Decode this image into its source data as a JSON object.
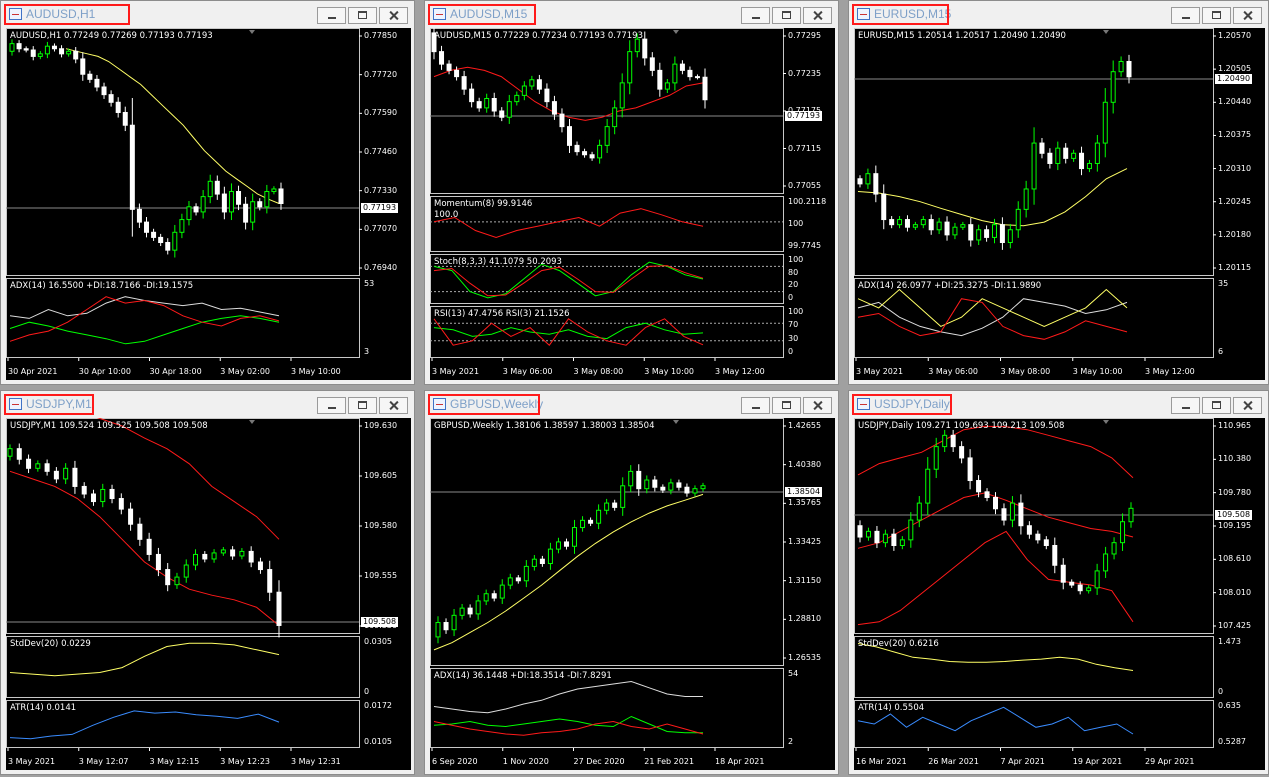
{
  "windows": [
    {
      "title": "AUDUSD,H1",
      "main": {
        "symbol_line": "AUDUSD,H1  0.77249 0.77269 0.77193 0.77193",
        "prices": [
          "0.77850",
          "0.77720",
          "0.77590",
          "0.77460",
          "0.77330",
          "0.77070",
          "0.76940"
        ],
        "current_price": "0.77193",
        "sub_panels": [
          {
            "label": "ADX(14) 16.5500 +DI:18.7166 -DI:19.1575",
            "scale": [
              "53",
              "3"
            ]
          }
        ]
      },
      "time_axis": [
        "30 Apr 2021",
        "30 Apr 10:00",
        "30 Apr 18:00",
        "3 May 02:00",
        "3 May 10:00"
      ]
    },
    {
      "title": "AUDUSD,M15",
      "main": {
        "symbol_line": "AUDUSD,M15  0.77229 0.77234 0.77193 0.77193",
        "prices": [
          "0.77295",
          "0.77235",
          "0.77175",
          "0.77115",
          "0.77055"
        ],
        "current_price": "0.77193",
        "sub_panels": [
          {
            "label": "Momentum(8) 99.9146",
            "extra": "100.0",
            "scale": [
              "100.2118",
              "100",
              "99.7745"
            ]
          },
          {
            "label": "Stoch(8,3,3) 41.1079 50.2093",
            "scale": [
              "100",
              "80",
              "20",
              "0"
            ]
          },
          {
            "label": "RSI(13) 47.4756  RSI(3) 21.1526",
            "scale": [
              "100",
              "70",
              "30",
              "0"
            ]
          }
        ]
      },
      "time_axis": [
        "3 May 2021",
        "3 May 06:00",
        "3 May 08:00",
        "3 May 10:00",
        "3 May 12:00"
      ]
    },
    {
      "title": "EURUSD,M15",
      "main": {
        "symbol_line": "EURUSD,M15  1.20514 1.20517 1.20490 1.20490",
        "prices": [
          "1.20570",
          "1.20505",
          "1.20440",
          "1.20375",
          "1.20310",
          "1.20245",
          "1.20180",
          "1.20115"
        ],
        "current_price": "1.20490",
        "sub_panels": [
          {
            "label": "ADX(14) 26.0977 +DI:25.3275 -DI:11.9890",
            "scale": [
              "35",
              "6"
            ]
          }
        ]
      },
      "time_axis": [
        "3 May 2021",
        "3 May 06:00",
        "3 May 08:00",
        "3 May 10:00",
        "3 May 12:00"
      ]
    },
    {
      "title": "USDJPY,M1",
      "main": {
        "symbol_line": "USDJPY,M1  109.524 109.525 109.508 109.508",
        "prices": [
          "109.630",
          "109.605",
          "109.580",
          "109.555",
          "109.530"
        ],
        "current_price": "109.508",
        "sub_panels": [
          {
            "label": "StdDev(20) 0.0229",
            "scale": [
              "0.0305",
              "0"
            ]
          },
          {
            "label": "ATR(14) 0.0141",
            "scale": [
              "0.0172",
              "0.0105"
            ]
          }
        ]
      },
      "time_axis": [
        "3 May 2021",
        "3 May 12:07",
        "3 May 12:15",
        "3 May 12:23",
        "3 May 12:31"
      ]
    },
    {
      "title": "GBPUSD,Weekly",
      "main": {
        "symbol_line": "GBPUSD,Weekly  1.38106 1.38597 1.38003 1.38504",
        "prices": [
          "1.42655",
          "1.40380",
          "1.35765",
          "1.33425",
          "1.31150",
          "1.28810",
          "1.26535"
        ],
        "current_price": "1.38504",
        "sub_panels": [
          {
            "label": "ADX(14) 36.1448 +DI:18.3514 -DI:7.8291",
            "scale": [
              "54",
              "2"
            ]
          }
        ]
      },
      "time_axis": [
        "6 Sep 2020",
        "1 Nov 2020",
        "27 Dec 2020",
        "21 Feb 2021",
        "18 Apr 2021"
      ]
    },
    {
      "title": "USDJPY,Daily",
      "main": {
        "symbol_line": "USDJPY,Daily  109.271 109.693 109.213 109.508",
        "prices": [
          "110.965",
          "110.380",
          "109.780",
          "109.195",
          "108.610",
          "108.010",
          "107.425"
        ],
        "current_price": "109.508",
        "sub_panels": [
          {
            "label": "StdDev(20) 0.6216",
            "scale": [
              "1.473",
              "0"
            ]
          },
          {
            "label": "ATR(14) 0.5504",
            "scale": [
              "0.635",
              "0.5287"
            ]
          }
        ]
      },
      "time_axis": [
        "16 Mar 2021",
        "26 Mar 2021",
        "7 Apr 2021",
        "19 Apr 2021",
        "29 Apr 2021"
      ]
    }
  ],
  "colors": {
    "bull": "#00ff00",
    "bear": "#ffffff",
    "ma": "#ffff66",
    "band": "#ff1a1a",
    "atr": "#3a8cff",
    "highlight": "#ff1a1a"
  },
  "series": {
    "w0": {
      "o": [
        0.7779,
        0.7782,
        0.778,
        0.77795,
        0.7777,
        0.7778,
        0.7781,
        0.778,
        0.7778,
        0.7779,
        0.7776,
        0.777,
        0.7768,
        0.7765,
        0.7762,
        0.7759,
        0.7755,
        0.775,
        0.7717,
        0.7712,
        0.7708,
        0.7706,
        0.7704,
        0.7701,
        0.7708,
        0.7713,
        0.7718,
        0.7716,
        0.7722,
        0.7728,
        0.7723,
        0.7716,
        0.7724,
        0.7719,
        0.7712,
        0.772,
        0.7718,
        0.7724,
        0.7725
      ],
      "c": [
        0.7782,
        0.778,
        0.77795,
        0.7777,
        0.7778,
        0.7781,
        0.778,
        0.7778,
        0.7779,
        0.7776,
        0.777,
        0.7768,
        0.7765,
        0.7762,
        0.7759,
        0.7755,
        0.775,
        0.7717,
        0.7712,
        0.7708,
        0.7706,
        0.7704,
        0.7701,
        0.7708,
        0.7713,
        0.7718,
        0.7716,
        0.7722,
        0.7728,
        0.7723,
        0.7716,
        0.7724,
        0.7719,
        0.7712,
        0.772,
        0.7718,
        0.7724,
        0.7725,
        0.77193
      ]
    },
    "w1": {
      "o": [
        0.773,
        0.7727,
        0.7725,
        0.7724,
        0.7723,
        0.7721,
        0.7719,
        0.7718,
        0.77195,
        0.77175,
        0.77165,
        0.7719,
        0.772,
        0.77215,
        0.77225,
        0.7721,
        0.7719,
        0.7717,
        0.7715,
        0.7712,
        0.7711,
        0.77105,
        0.771,
        0.7712,
        0.7715,
        0.7718,
        0.7722,
        0.7727,
        0.7729,
        0.7726,
        0.7724,
        0.7721,
        0.7722,
        0.7725,
        0.7724,
        0.7723,
        0.77229
      ],
      "c": [
        0.7727,
        0.7725,
        0.7724,
        0.7723,
        0.7721,
        0.7719,
        0.7718,
        0.77195,
        0.77175,
        0.77165,
        0.7719,
        0.772,
        0.77215,
        0.77225,
        0.7721,
        0.7719,
        0.7717,
        0.7715,
        0.7712,
        0.7711,
        0.77105,
        0.771,
        0.7712,
        0.7715,
        0.7718,
        0.7722,
        0.7727,
        0.7729,
        0.7726,
        0.7724,
        0.7721,
        0.7722,
        0.7725,
        0.7724,
        0.7723,
        0.77229,
        0.77193
      ]
    },
    "w2": {
      "o": [
        1.2029,
        1.2028,
        1.203,
        1.2026,
        1.2021,
        1.202,
        1.2021,
        1.20195,
        1.202,
        1.2021,
        1.2019,
        1.20205,
        1.2018,
        1.20195,
        1.202,
        1.2017,
        1.2019,
        1.20175,
        1.202,
        1.20165,
        1.2019,
        1.2023,
        1.2027,
        1.2036,
        1.2034,
        1.2032,
        1.2035,
        1.2033,
        1.2034,
        1.2031,
        1.2032,
        1.2036,
        1.2044,
        1.205,
        1.2052
      ],
      "c": [
        1.2028,
        1.203,
        1.2026,
        1.2021,
        1.202,
        1.2021,
        1.20195,
        1.202,
        1.2021,
        1.2019,
        1.20205,
        1.2018,
        1.20195,
        1.202,
        1.2017,
        1.2019,
        1.20175,
        1.202,
        1.20165,
        1.2019,
        1.2023,
        1.2027,
        1.2036,
        1.2034,
        1.2032,
        1.2035,
        1.2033,
        1.2034,
        1.2031,
        1.2032,
        1.2036,
        1.2044,
        1.205,
        1.2052,
        1.2049
      ]
    },
    "w3": {
      "o": [
        109.62,
        109.625,
        109.618,
        109.612,
        109.615,
        109.61,
        109.605,
        109.612,
        109.6,
        109.595,
        109.59,
        109.598,
        109.592,
        109.585,
        109.575,
        109.565,
        109.555,
        109.545,
        109.535,
        109.54,
        109.548,
        109.555,
        109.552,
        109.556,
        109.558,
        109.554,
        109.557,
        109.55,
        109.545,
        109.53
      ],
      "c": [
        109.625,
        109.618,
        109.612,
        109.615,
        109.61,
        109.605,
        109.612,
        109.6,
        109.595,
        109.59,
        109.598,
        109.592,
        109.585,
        109.575,
        109.565,
        109.555,
        109.545,
        109.535,
        109.54,
        109.548,
        109.555,
        109.552,
        109.556,
        109.558,
        109.554,
        109.557,
        109.55,
        109.545,
        109.53,
        109.508
      ]
    },
    "w4": {
      "o": [
        1.28,
        1.29,
        1.285,
        1.295,
        1.3,
        1.296,
        1.305,
        1.31,
        1.307,
        1.316,
        1.321,
        1.319,
        1.329,
        1.334,
        1.331,
        1.341,
        1.346,
        1.343,
        1.356,
        1.361,
        1.359,
        1.368,
        1.373,
        1.37,
        1.385,
        1.395,
        1.383,
        1.389,
        1.384,
        1.382,
        1.387,
        1.384,
        1.38,
        1.383
      ],
      "c": [
        1.29,
        1.285,
        1.295,
        1.3,
        1.296,
        1.305,
        1.31,
        1.307,
        1.316,
        1.321,
        1.319,
        1.329,
        1.334,
        1.331,
        1.341,
        1.346,
        1.343,
        1.356,
        1.361,
        1.359,
        1.368,
        1.373,
        1.37,
        1.385,
        1.395,
        1.383,
        1.389,
        1.384,
        1.382,
        1.387,
        1.384,
        1.38,
        1.383,
        1.38504
      ]
    },
    "w5": {
      "o": [
        109.2,
        109.0,
        109.1,
        108.9,
        109.05,
        108.85,
        108.95,
        109.3,
        109.6,
        110.2,
        110.6,
        110.8,
        110.6,
        110.4,
        110.0,
        109.8,
        109.7,
        109.5,
        109.3,
        109.6,
        109.2,
        109.05,
        108.95,
        108.85,
        108.5,
        108.2,
        108.15,
        108.05,
        108.1,
        108.4,
        108.7,
        108.9,
        109.271
      ],
      "c": [
        109.0,
        109.1,
        108.9,
        109.05,
        108.85,
        108.95,
        109.3,
        109.6,
        110.2,
        110.6,
        110.8,
        110.6,
        110.4,
        110.0,
        109.8,
        109.7,
        109.5,
        109.3,
        109.6,
        109.2,
        109.05,
        108.95,
        108.85,
        108.5,
        108.2,
        108.15,
        108.05,
        108.1,
        108.4,
        108.7,
        108.9,
        109.271,
        109.508
      ]
    }
  },
  "indicator_lines": {
    "w0": {
      "ma": [
        0.778,
        0.7779,
        0.7778,
        0.7777,
        0.7775,
        0.7772,
        0.7769,
        0.7766,
        0.7762,
        0.7758,
        0.7754,
        0.775,
        0.7745,
        0.774,
        0.7736,
        0.7732,
        0.7729,
        0.7726,
        0.7723,
        0.7721,
        0.77193
      ],
      "adx": [
        [
          30,
          28,
          35,
          30,
          32,
          40,
          45,
          42,
          40,
          38,
          40,
          35,
          36,
          33,
          30
        ],
        [
          20,
          25,
          22,
          18,
          15,
          12,
          8,
          10,
          15,
          20,
          25,
          28,
          30,
          28,
          25
        ],
        [
          10,
          15,
          18,
          25,
          35,
          45,
          40,
          42,
          38,
          30,
          25,
          22,
          28,
          30,
          26
        ]
      ]
    },
    "w1": {
      "ma": [
        0.7723,
        0.7724,
        0.77245,
        0.7724,
        0.7723,
        0.7721,
        0.7719,
        0.77175,
        0.77165,
        0.7716,
        0.77165,
        0.77175,
        0.7718,
        0.7719,
        0.772,
        0.77215,
        0.7722
      ],
      "bands": [],
      "mom": [
        100.0,
        100.05,
        99.9,
        99.82,
        99.9,
        99.95,
        100.0,
        100.05,
        99.95,
        100.1,
        100.15,
        100.08,
        100.0,
        99.95
      ],
      "stoch": [
        [
          80,
          70,
          20,
          5,
          15,
          50,
          85,
          70,
          40,
          10,
          20,
          60,
          90,
          80,
          60,
          50
        ],
        [
          70,
          75,
          40,
          10,
          12,
          40,
          70,
          78,
          50,
          20,
          18,
          50,
          80,
          82,
          65,
          52
        ]
      ],
      "rsi": [
        [
          60,
          55,
          40,
          45,
          60,
          50,
          45,
          55,
          40,
          35,
          60,
          70,
          55,
          45,
          48
        ],
        [
          80,
          20,
          30,
          70,
          40,
          60,
          20,
          80,
          50,
          30,
          20,
          60,
          80,
          40,
          21
        ]
      ]
    },
    "w2": {
      "ma": [
        1.20265,
        1.20262,
        1.20255,
        1.20245,
        1.20232,
        1.2022,
        1.20208,
        1.202,
        1.20198,
        1.20205,
        1.20225,
        1.20255,
        1.2029,
        1.2031
      ],
      "adx": [
        [
          25,
          28,
          20,
          15,
          12,
          10,
          14,
          20,
          30,
          28,
          26,
          22,
          24,
          28
        ],
        [
          30,
          25,
          35,
          25,
          15,
          20,
          30,
          25,
          20,
          15,
          20,
          25,
          35,
          25
        ],
        [
          20,
          22,
          15,
          10,
          12,
          30,
          28,
          15,
          10,
          8,
          12,
          18,
          15,
          12
        ]
      ]
    },
    "w3": {
      "upper": [
        109.66,
        109.658,
        109.655,
        109.65,
        109.645,
        109.64,
        109.632,
        109.625,
        109.615,
        109.6,
        109.59,
        109.58,
        109.565
      ],
      "lower": [
        109.61,
        109.605,
        109.6,
        109.592,
        109.58,
        109.565,
        109.55,
        109.54,
        109.532,
        109.528,
        109.525,
        109.52,
        109.508
      ],
      "std": [
        0.012,
        0.011,
        0.01,
        0.011,
        0.012,
        0.015,
        0.022,
        0.028,
        0.03,
        0.03,
        0.029,
        0.026,
        0.023
      ],
      "atr": [
        0.0112,
        0.011,
        0.0115,
        0.0118,
        0.0135,
        0.015,
        0.0162,
        0.0158,
        0.016,
        0.0155,
        0.0152,
        0.0148,
        0.0156,
        0.0141
      ]
    },
    "w4": {
      "ma": [
        1.271,
        1.276,
        1.283,
        1.29,
        1.298,
        1.307,
        1.316,
        1.326,
        1.336,
        1.345,
        1.353,
        1.36,
        1.366,
        1.371,
        1.375,
        1.379
      ],
      "adx": [
        [
          30,
          28,
          26,
          25,
          28,
          32,
          35,
          40,
          44,
          46,
          48,
          50,
          45,
          40,
          38,
          38
        ],
        [
          15,
          16,
          18,
          15,
          14,
          16,
          18,
          20,
          18,
          15,
          14,
          22,
          16,
          10,
          9,
          9
        ],
        [
          18,
          15,
          12,
          10,
          8,
          7,
          9,
          10,
          12,
          16,
          18,
          14,
          12,
          16,
          12,
          8
        ]
      ]
    },
    "w5": {
      "upper": [
        110.1,
        110.3,
        110.4,
        110.5,
        110.7,
        110.9,
        110.96,
        110.95,
        110.9,
        110.8,
        110.7,
        110.6,
        110.4,
        110.05
      ],
      "lower": [
        107.45,
        107.5,
        107.7,
        108.0,
        108.3,
        108.6,
        108.9,
        109.1,
        108.6,
        108.25,
        108.2,
        108.15,
        108.05,
        107.5
      ],
      "mid": [
        108.8,
        108.9,
        109.1,
        109.3,
        109.5,
        109.7,
        109.78,
        109.65,
        109.5,
        109.35,
        109.25,
        109.15,
        109.1,
        109.0
      ],
      "std": [
        1.4,
        1.3,
        1.15,
        1.0,
        0.95,
        0.88,
        0.86,
        0.86,
        0.88,
        0.92,
        0.95,
        1.0,
        0.95,
        0.8,
        0.7,
        0.62
      ],
      "atr": [
        0.59,
        0.58,
        0.61,
        0.57,
        0.6,
        0.58,
        0.56,
        0.59,
        0.61,
        0.63,
        0.6,
        0.57,
        0.58,
        0.6,
        0.56,
        0.57,
        0.58,
        0.55
      ]
    }
  }
}
